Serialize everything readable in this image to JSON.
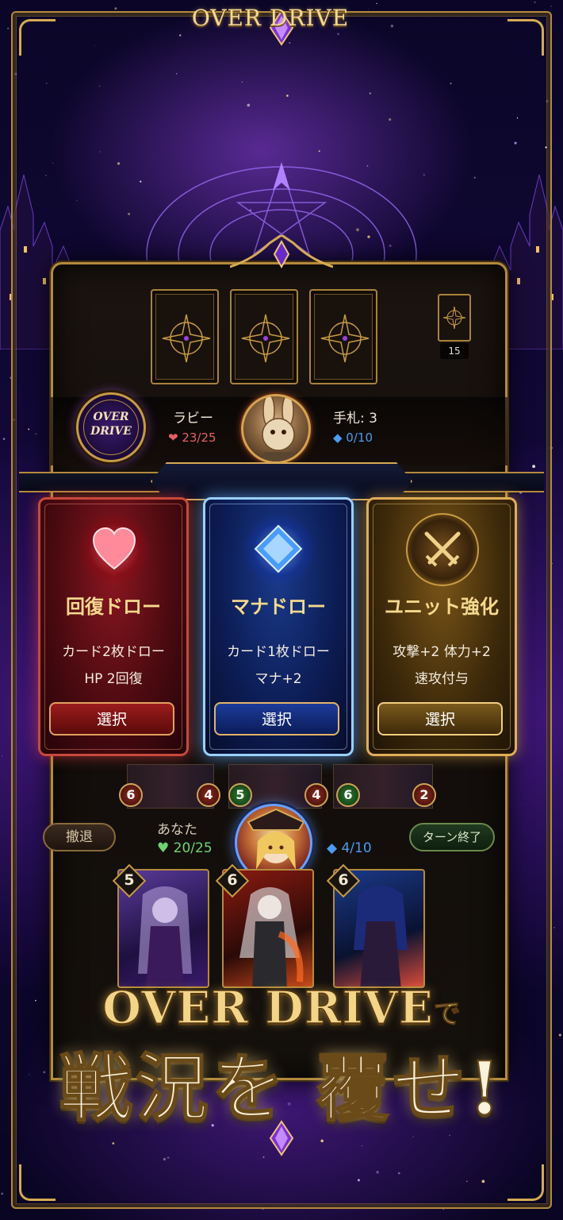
{
  "colors": {
    "gold": "#d8aa55",
    "hp_red": "#e36060",
    "mana_blue": "#4d9bf0",
    "hp_green": "#6fd36f"
  },
  "opponent": {
    "emblem_line1": "OVER",
    "emblem_line2": "DRIVE",
    "name": "ラビー",
    "hp": "❤ 23/25",
    "hand": "手札: 3",
    "mana": "◆ 0/10",
    "deck_count": "15"
  },
  "banner": {
    "title": "OVER DRIVE"
  },
  "choices": [
    {
      "icon": "heart-icon",
      "title": "回復ドロー",
      "desc_line1": "カード2枚ドロー",
      "desc_line2": "HP 2回復",
      "button": "選択"
    },
    {
      "icon": "diamond-icon",
      "title": "マナドロー",
      "desc_line1": "カード1枚ドロー",
      "desc_line2": "マナ+2",
      "button": "選択"
    },
    {
      "icon": "crossed-swords-icon",
      "title": "ユニット強化",
      "desc_line1": "攻撃+2 体力+2",
      "desc_line2": "速攻付与",
      "button": "選択"
    }
  ],
  "field": {
    "stats": [
      "6",
      "4",
      "5",
      "4",
      "6",
      "2"
    ]
  },
  "player": {
    "retreat": "撤退",
    "end_turn": "ターン終了",
    "name": "あなた",
    "hp": "♥ 20/25",
    "mana": "◆ 4/10",
    "hand_costs": [
      "5",
      "6",
      "6"
    ]
  },
  "headline": {
    "line1_main": "OVER DRIVE",
    "line1_suffix": "で",
    "line2": "戦況を 覆せ!"
  }
}
